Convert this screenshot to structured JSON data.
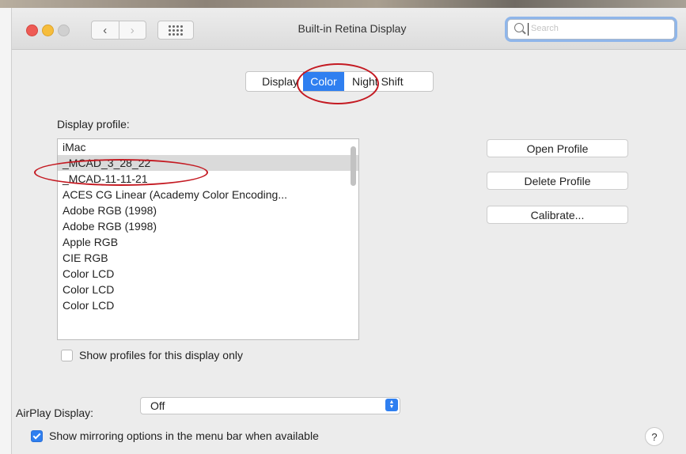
{
  "window": {
    "title": "Built-in Retina Display"
  },
  "search": {
    "placeholder": "Search"
  },
  "tabs": [
    {
      "label": "Display",
      "selected": false
    },
    {
      "label": "Color",
      "selected": true
    },
    {
      "label": "Night Shift",
      "selected": false
    }
  ],
  "profile": {
    "label": "Display profile:",
    "items": [
      "iMac",
      "_MCAD_3_28_22",
      "_MCAD-11-11-21",
      "ACES CG Linear (Academy Color Encoding...",
      "Adobe RGB (1998)",
      "Adobe RGB (1998)",
      "Apple RGB",
      "CIE RGB",
      "Color LCD",
      "Color LCD",
      "Color LCD"
    ],
    "selected_index": 1,
    "show_only_label": "Show profiles for this display only",
    "show_only_checked": false
  },
  "buttons": {
    "open": "Open Profile",
    "delete": "Delete Profile",
    "calibrate": "Calibrate..."
  },
  "airplay": {
    "label": "AirPlay Display:",
    "value": "Off"
  },
  "mirroring": {
    "label": "Show mirroring options in the menu bar when available",
    "checked": true
  },
  "help": {
    "label": "?"
  },
  "colors": {
    "accent": "#2f7ff0",
    "annotation": "#c41a22"
  }
}
